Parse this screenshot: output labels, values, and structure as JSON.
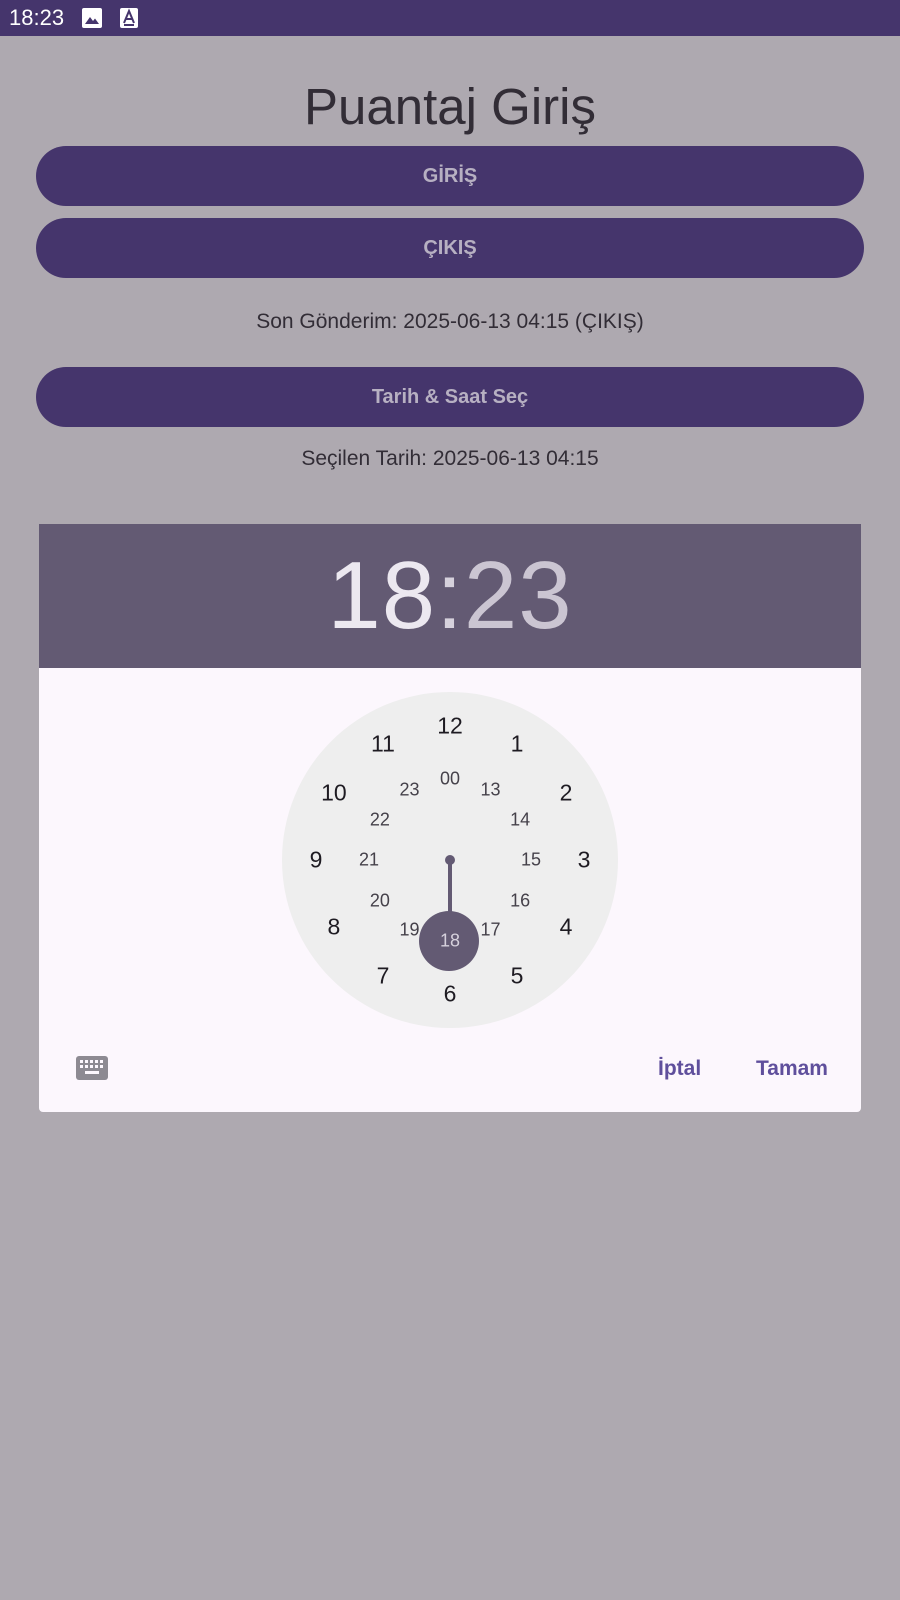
{
  "status_bar": {
    "time": "18:23",
    "icons": [
      "image-icon",
      "text-a-icon"
    ]
  },
  "page": {
    "title": "Puantaj Giriş",
    "giris_label": "GİRİŞ",
    "cikis_label": "ÇIKIŞ",
    "last_sent": "Son Gönderim: 2025-06-13 04:15 (ÇIKIŞ)",
    "pick_datetime_label": "Tarih & Saat Seç",
    "selected_date": "Seçilen Tarih: 2025-06-13 04:15"
  },
  "time_picker": {
    "hour": "18",
    "separator": ":",
    "minute": "23",
    "selected_value": "18",
    "outer_numbers": [
      "12",
      "1",
      "2",
      "3",
      "4",
      "5",
      "6",
      "7",
      "8",
      "9",
      "10",
      "11"
    ],
    "inner_numbers": [
      "00",
      "13",
      "14",
      "15",
      "16",
      "17",
      "18",
      "19",
      "20",
      "21",
      "22",
      "23"
    ],
    "cancel_label": "İptal",
    "ok_label": "Tamam",
    "keyboard_icon": "keyboard-icon"
  },
  "colors": {
    "primary": "#45356c",
    "header": "#635a73",
    "background": "#aea9b0",
    "dialog_bg": "#fcf7fd",
    "clock_bg": "#eeeeee",
    "accent_text": "#5f4f9c"
  }
}
